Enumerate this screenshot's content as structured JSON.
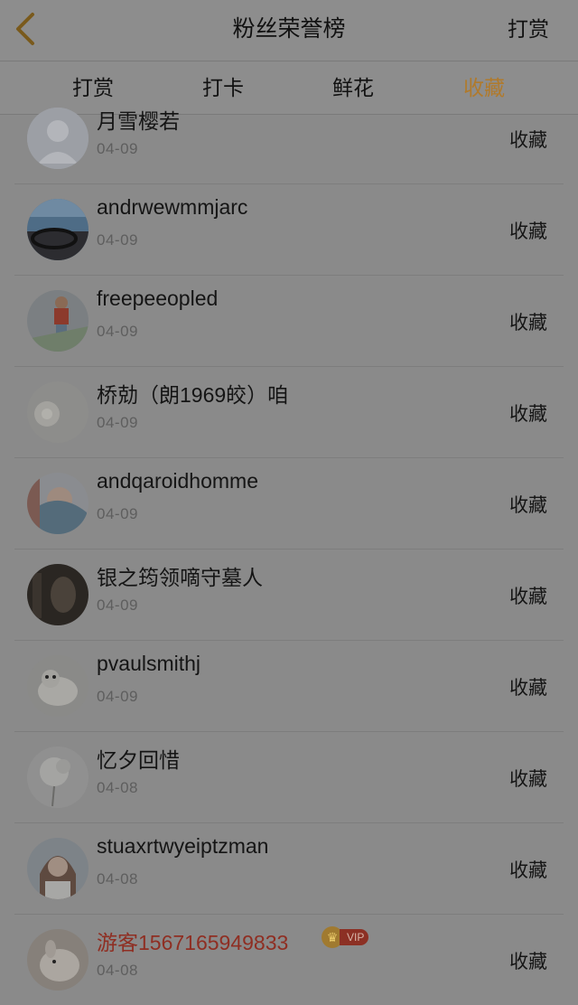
{
  "header": {
    "title": "粉丝荣誉榜",
    "right_action": "打赏",
    "back_icon": "chevron-left-icon",
    "accent_color": "#b07a2c"
  },
  "tabs": [
    {
      "label": "打赏",
      "active": false
    },
    {
      "label": "打卡",
      "active": false
    },
    {
      "label": "鲜花",
      "active": false
    },
    {
      "label": "收藏",
      "active": true
    }
  ],
  "fans": [
    {
      "name": "月雪樱若",
      "date": "04-09",
      "action": "收藏"
    },
    {
      "name": "andrwewmmjarc",
      "date": "04-09",
      "action": "收藏"
    },
    {
      "name": "freepeeopled",
      "date": "04-09",
      "action": "收藏"
    },
    {
      "name": "桥勀（朗1969皎）咱",
      "date": "04-09",
      "action": "收藏"
    },
    {
      "name": "andqaroidhomme",
      "date": "04-09",
      "action": "收藏"
    },
    {
      "name": "银之筠领嘀守墓人",
      "date": "04-09",
      "action": "收藏"
    },
    {
      "name": "pvaulsmithj",
      "date": "04-09",
      "action": "收藏"
    },
    {
      "name": "忆夕回惜",
      "date": "04-08",
      "action": "收藏"
    },
    {
      "name": "stuaxrtwyeiptzman",
      "date": "04-08",
      "action": "收藏"
    },
    {
      "name": "游客1567165949833",
      "date": "04-08",
      "action": "收藏",
      "vip": "VIP",
      "guest_color": "#8f2e22"
    }
  ]
}
